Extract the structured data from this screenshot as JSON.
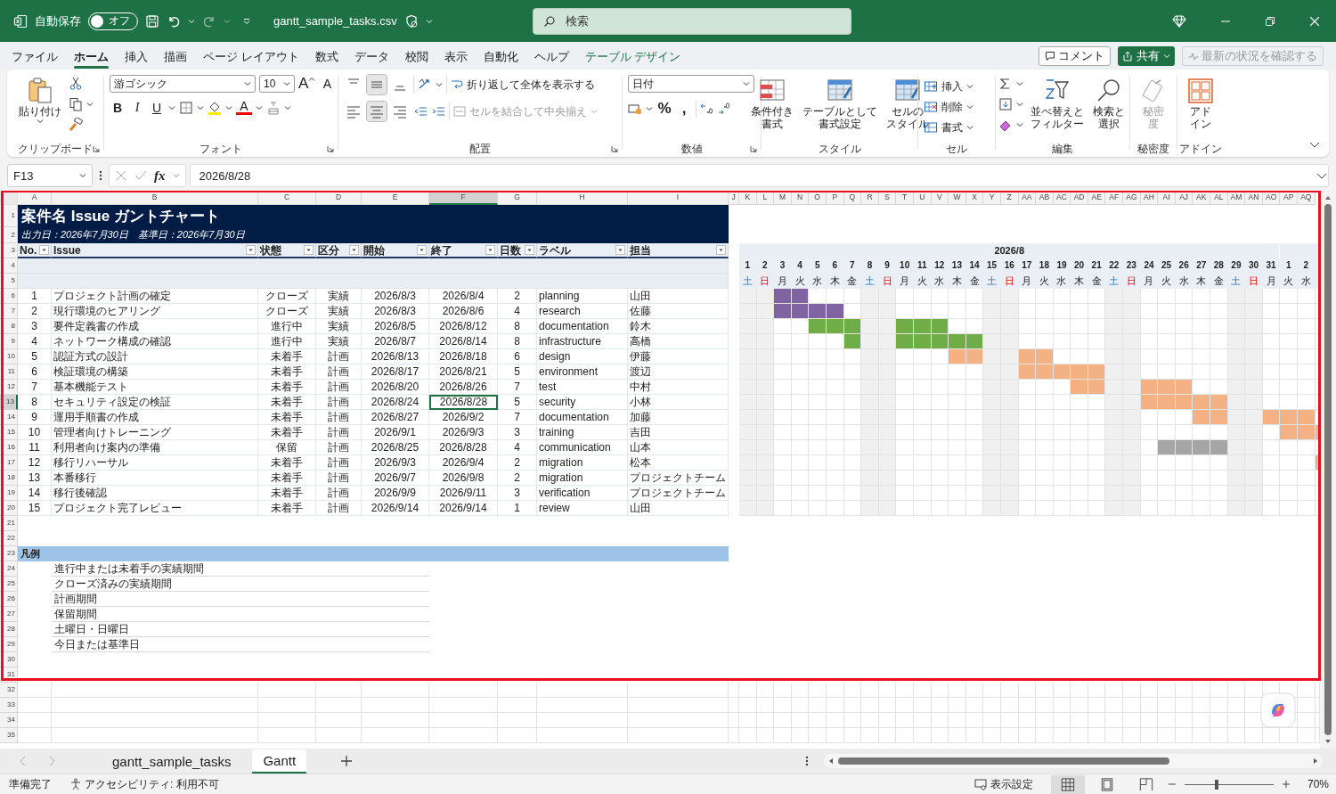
{
  "title_bar": {
    "autosave_label": "自動保存",
    "autosave": {
      "label": "オフ",
      "on": false
    },
    "file_name": "gantt_sample_tasks.csv",
    "search_placeholder": "検索"
  },
  "menu_tabs": [
    {
      "label": "ファイル",
      "selected": false,
      "kind": "standard"
    },
    {
      "label": "ホーム",
      "selected": true,
      "kind": "standard"
    },
    {
      "label": "挿入",
      "selected": false,
      "kind": "standard"
    },
    {
      "label": "描画",
      "selected": false,
      "kind": "standard"
    },
    {
      "label": "ページ レイアウト",
      "selected": false,
      "kind": "standard"
    },
    {
      "label": "数式",
      "selected": false,
      "kind": "standard"
    },
    {
      "label": "データ",
      "selected": false,
      "kind": "standard"
    },
    {
      "label": "校閲",
      "selected": false,
      "kind": "standard"
    },
    {
      "label": "表示",
      "selected": false,
      "kind": "standard"
    },
    {
      "label": "自動化",
      "selected": false,
      "kind": "standard"
    },
    {
      "label": "ヘルプ",
      "selected": false,
      "kind": "standard"
    },
    {
      "label": "テーブル デザイン",
      "selected": false,
      "kind": "contextual"
    }
  ],
  "actions": {
    "comment": "コメント",
    "share": "共有",
    "catch_up": {
      "label": "最新の状況を確認する",
      "disabled": true
    }
  },
  "ribbon": {
    "clipboard": {
      "label": "クリップボード",
      "paste": "貼り付け"
    },
    "font": {
      "label": "フォント",
      "font_name": "游ゴシック",
      "font_size": "10",
      "grow": "A",
      "shrink": "A",
      "styles": [
        {
          "label": "B",
          "kind": "bold"
        },
        {
          "label": "I",
          "kind": "italic"
        },
        {
          "label": "U",
          "kind": "underline"
        }
      ],
      "font_color": "A"
    },
    "alignment": {
      "label": "配置",
      "vertical_align": [
        {
          "selected": false
        },
        {
          "selected": true
        },
        {
          "selected": false
        }
      ],
      "horizontal_align": [
        {
          "selected": false
        },
        {
          "selected": true
        },
        {
          "selected": false
        }
      ],
      "wrap_text": "折り返して全体を表示する",
      "merge": {
        "label": "セルを結合して中央揃え",
        "disabled": true
      }
    },
    "number": {
      "label": "数値",
      "format": "日付",
      "symbols": [
        "%",
        ","
      ]
    },
    "styles": {
      "label": "スタイル",
      "buttons": [
        {
          "kind": "conditional",
          "lines": [
            "条件付き",
            "書式"
          ]
        },
        {
          "kind": "table",
          "lines": [
            "テーブルとして",
            "書式設定"
          ]
        },
        {
          "kind": "cell_style",
          "lines": [
            "セルの",
            "スタイル"
          ]
        }
      ]
    },
    "cells": {
      "label": "セル",
      "buttons": [
        {
          "kind": "insert",
          "label": "挿入"
        },
        {
          "kind": "delete",
          "label": "削除"
        },
        {
          "kind": "format",
          "label": "書式"
        }
      ]
    },
    "editing": {
      "label": "編集",
      "buttons": [
        {
          "kind": "sort",
          "lines": [
            "並べ替えと",
            "フィルター"
          ]
        },
        {
          "kind": "find",
          "lines": [
            "検索と",
            "選択"
          ]
        }
      ]
    },
    "sensitivity": {
      "label": "秘密度",
      "button": {
        "lines": [
          "秘密",
          "度"
        ],
        "disabled": true
      }
    },
    "addins": {
      "label": "アドイン",
      "button": {
        "lines": [
          "アド",
          "イン"
        ]
      }
    }
  },
  "formula_bar": {
    "name_box": "F13",
    "fx": "fx",
    "value": "2026/8/28"
  },
  "sheet": {
    "column_headers": [
      {
        "label": "A",
        "selected": false
      },
      {
        "label": "B",
        "selected": false
      },
      {
        "label": "C",
        "selected": false
      },
      {
        "label": "D",
        "selected": false
      },
      {
        "label": "E",
        "selected": false
      },
      {
        "label": "F",
        "selected": true
      },
      {
        "label": "G",
        "selected": false
      },
      {
        "label": "H",
        "selected": false
      },
      {
        "label": "I",
        "selected": false
      },
      {
        "label": "J",
        "selected": false
      },
      {
        "label": "K",
        "selected": false
      },
      {
        "label": "L",
        "selected": false
      },
      {
        "label": "M",
        "selected": false
      },
      {
        "label": "N",
        "selected": false
      },
      {
        "label": "O",
        "selected": false
      },
      {
        "label": "P",
        "selected": false
      },
      {
        "label": "Q",
        "selected": false
      },
      {
        "label": "R",
        "selected": false
      },
      {
        "label": "S",
        "selected": false
      },
      {
        "label": "T",
        "selected": false
      },
      {
        "label": "U",
        "selected": false
      },
      {
        "label": "V",
        "selected": false
      },
      {
        "label": "W",
        "selected": false
      },
      {
        "label": "X",
        "selected": false
      },
      {
        "label": "Y",
        "selected": false
      },
      {
        "label": "Z",
        "selected": false
      },
      {
        "label": "AA",
        "selected": false
      },
      {
        "label": "AB",
        "selected": false
      },
      {
        "label": "AC",
        "selected": false
      },
      {
        "label": "AD",
        "selected": false
      },
      {
        "label": "AE",
        "selected": false
      },
      {
        "label": "AF",
        "selected": false
      },
      {
        "label": "AG",
        "selected": false
      },
      {
        "label": "AH",
        "selected": false
      },
      {
        "label": "AI",
        "selected": false
      },
      {
        "label": "AJ",
        "selected": false
      },
      {
        "label": "AK",
        "selected": false
      },
      {
        "label": "AL",
        "selected": false
      },
      {
        "label": "AM",
        "selected": false
      },
      {
        "label": "AN",
        "selected": false
      },
      {
        "label": "AO",
        "selected": false
      },
      {
        "label": "AP",
        "selected": false
      },
      {
        "label": "AQ",
        "selected": false
      }
    ],
    "row_headers": [
      {
        "label": "1",
        "selected": false
      },
      {
        "label": "2",
        "selected": false
      },
      {
        "label": "3",
        "selected": false
      },
      {
        "label": "4",
        "selected": false
      },
      {
        "label": "5",
        "selected": false
      },
      {
        "label": "6",
        "selected": false
      },
      {
        "label": "7",
        "selected": false
      },
      {
        "label": "8",
        "selected": false
      },
      {
        "label": "9",
        "selected": false
      },
      {
        "label": "10",
        "selected": false
      },
      {
        "label": "11",
        "selected": false
      },
      {
        "label": "12",
        "selected": false
      },
      {
        "label": "13",
        "selected": true
      },
      {
        "label": "14",
        "selected": false
      },
      {
        "label": "15",
        "selected": false
      },
      {
        "label": "16",
        "selected": false
      },
      {
        "label": "17",
        "selected": false
      },
      {
        "label": "18",
        "selected": false
      },
      {
        "label": "19",
        "selected": false
      },
      {
        "label": "20",
        "selected": false
      },
      {
        "label": "21",
        "selected": false
      },
      {
        "label": "22",
        "selected": false
      },
      {
        "label": "23",
        "selected": false
      },
      {
        "label": "24",
        "selected": false
      },
      {
        "label": "25",
        "selected": false
      },
      {
        "label": "26",
        "selected": false
      },
      {
        "label": "27",
        "selected": false
      },
      {
        "label": "28",
        "selected": false
      },
      {
        "label": "29",
        "selected": false
      },
      {
        "label": "30",
        "selected": false
      },
      {
        "label": "31",
        "selected": false
      },
      {
        "label": "32",
        "selected": false
      },
      {
        "label": "33",
        "selected": false
      },
      {
        "label": "34",
        "selected": false
      },
      {
        "label": "35",
        "selected": false
      }
    ]
  },
  "table": {
    "title": "案件名 Issue ガントチャート",
    "subtitle": "出力日：2026年7月30日　基準日：2026年7月30日",
    "columns": [
      "No.",
      "Issue",
      "状態",
      "区分",
      "開始",
      "終了",
      "日数",
      "ラベル",
      "担当"
    ],
    "rows": [
      {
        "cells": [
          "1",
          "プロジェクト計画の確定",
          "クローズ",
          "実績",
          "2026/8/3",
          "2026/8/4",
          "2",
          "planning",
          "山田"
        ],
        "kind": "closed",
        "active": false
      },
      {
        "cells": [
          "2",
          "現行環境のヒアリング",
          "クローズ",
          "実績",
          "2026/8/3",
          "2026/8/6",
          "4",
          "research",
          "佐藤"
        ],
        "kind": "closed",
        "active": false
      },
      {
        "cells": [
          "3",
          "要件定義書の作成",
          "進行中",
          "実績",
          "2026/8/5",
          "2026/8/12",
          "8",
          "documentation",
          "鈴木"
        ],
        "kind": "in_progress",
        "active": false
      },
      {
        "cells": [
          "4",
          "ネットワーク構成の確認",
          "進行中",
          "実績",
          "2026/8/7",
          "2026/8/14",
          "8",
          "infrastructure",
          "高橋"
        ],
        "kind": "in_progress",
        "active": false
      },
      {
        "cells": [
          "5",
          "認証方式の設計",
          "未着手",
          "計画",
          "2026/8/13",
          "2026/8/18",
          "6",
          "design",
          "伊藤"
        ],
        "kind": "planned",
        "active": false
      },
      {
        "cells": [
          "6",
          "検証環境の構築",
          "未着手",
          "計画",
          "2026/8/17",
          "2026/8/21",
          "5",
          "environment",
          "渡辺"
        ],
        "kind": "planned",
        "active": false
      },
      {
        "cells": [
          "7",
          "基本機能テスト",
          "未着手",
          "計画",
          "2026/8/20",
          "2026/8/26",
          "7",
          "test",
          "中村"
        ],
        "kind": "planned",
        "active": false
      },
      {
        "cells": [
          "8",
          "セキュリティ設定の検証",
          "未着手",
          "計画",
          "2026/8/24",
          "2026/8/28",
          "5",
          "security",
          "小林"
        ],
        "kind": "planned",
        "active": true
      },
      {
        "cells": [
          "9",
          "運用手順書の作成",
          "未着手",
          "計画",
          "2026/8/27",
          "2026/9/2",
          "7",
          "documentation",
          "加藤"
        ],
        "kind": "planned",
        "active": false
      },
      {
        "cells": [
          "10",
          "管理者向けトレーニング",
          "未着手",
          "計画",
          "2026/9/1",
          "2026/9/3",
          "3",
          "training",
          "吉田"
        ],
        "kind": "planned",
        "active": false
      },
      {
        "cells": [
          "11",
          "利用者向け案内の準備",
          "保留",
          "計画",
          "2026/8/25",
          "2026/8/28",
          "4",
          "communication",
          "山本"
        ],
        "kind": "on_hold",
        "active": false
      },
      {
        "cells": [
          "12",
          "移行リハーサル",
          "未着手",
          "計画",
          "2026/9/3",
          "2026/9/4",
          "2",
          "migration",
          "松本"
        ],
        "kind": "planned",
        "active": false
      },
      {
        "cells": [
          "13",
          "本番移行",
          "未着手",
          "計画",
          "2026/9/7",
          "2026/9/8",
          "2",
          "migration",
          "プロジェクトチーム"
        ],
        "active": false
      },
      {
        "cells": [
          "14",
          "移行後確認",
          "未着手",
          "計画",
          "2026/9/9",
          "2026/9/11",
          "3",
          "verification",
          "プロジェクトチーム"
        ],
        "active": false
      },
      {
        "cells": [
          "15",
          "プロジェクト完了レビュー",
          "未着手",
          "計画",
          "2026/9/14",
          "2026/9/14",
          "1",
          "review",
          "山田"
        ],
        "active": false
      }
    ]
  },
  "gantt": {
    "month": "2026/8",
    "days": [
      {
        "day": "1",
        "weekday": "土",
        "kind": "saturday"
      },
      {
        "day": "2",
        "weekday": "日",
        "kind": "sunday"
      },
      {
        "day": "3",
        "weekday": "月",
        "kind": "weekday"
      },
      {
        "day": "4",
        "weekday": "火",
        "kind": "weekday"
      },
      {
        "day": "5",
        "weekday": "水",
        "kind": "weekday"
      },
      {
        "day": "6",
        "weekday": "木",
        "kind": "weekday"
      },
      {
        "day": "7",
        "weekday": "金",
        "kind": "weekday"
      },
      {
        "day": "8",
        "weekday": "土",
        "kind": "saturday"
      },
      {
        "day": "9",
        "weekday": "日",
        "kind": "sunday"
      },
      {
        "day": "10",
        "weekday": "月",
        "kind": "weekday"
      },
      {
        "day": "11",
        "weekday": "火",
        "kind": "weekday"
      },
      {
        "day": "12",
        "weekday": "水",
        "kind": "weekday"
      },
      {
        "day": "13",
        "weekday": "木",
        "kind": "weekday"
      },
      {
        "day": "14",
        "weekday": "金",
        "kind": "weekday"
      },
      {
        "day": "15",
        "weekday": "土",
        "kind": "saturday"
      },
      {
        "day": "16",
        "weekday": "日",
        "kind": "sunday"
      },
      {
        "day": "17",
        "weekday": "月",
        "kind": "weekday"
      },
      {
        "day": "18",
        "weekday": "火",
        "kind": "weekday"
      },
      {
        "day": "19",
        "weekday": "水",
        "kind": "weekday"
      },
      {
        "day": "20",
        "weekday": "木",
        "kind": "weekday"
      },
      {
        "day": "21",
        "weekday": "金",
        "kind": "weekday"
      },
      {
        "day": "22",
        "weekday": "土",
        "kind": "saturday"
      },
      {
        "day": "23",
        "weekday": "日",
        "kind": "sunday"
      },
      {
        "day": "24",
        "weekday": "月",
        "kind": "weekday"
      },
      {
        "day": "25",
        "weekday": "火",
        "kind": "weekday"
      },
      {
        "day": "26",
        "weekday": "水",
        "kind": "weekday"
      },
      {
        "day": "27",
        "weekday": "木",
        "kind": "weekday"
      },
      {
        "day": "28",
        "weekday": "金",
        "kind": "weekday"
      },
      {
        "day": "29",
        "weekday": "土",
        "kind": "saturday"
      },
      {
        "day": "30",
        "weekday": "日",
        "kind": "sunday"
      },
      {
        "day": "31",
        "weekday": "月",
        "kind": "weekday"
      },
      {
        "day": "1",
        "weekday": "火",
        "kind": "weekday"
      },
      {
        "day": "2",
        "weekday": "水",
        "kind": "weekday"
      }
    ]
  },
  "legend": {
    "title": "凡例",
    "items": [
      "進行中または未着手の実績期間",
      "クローズ済みの実績期間",
      "計画期間",
      "保留期間",
      "土曜日・日曜日",
      "今日または基準日"
    ]
  },
  "sheet_tabs": [
    {
      "label": "gantt_sample_tasks",
      "selected": false
    },
    {
      "label": "Gantt",
      "selected": true
    }
  ],
  "status_bar": {
    "ready": "準備完了",
    "accessibility": "アクセシビリティ: 利用不可",
    "display_settings": "表示設定",
    "views": [
      {
        "kind": "normal",
        "selected": true
      },
      {
        "kind": "page_layout",
        "selected": false
      },
      {
        "kind": "page_break",
        "selected": false
      }
    ],
    "zoom": {
      "level": 0.36,
      "label": "70%"
    }
  }
}
